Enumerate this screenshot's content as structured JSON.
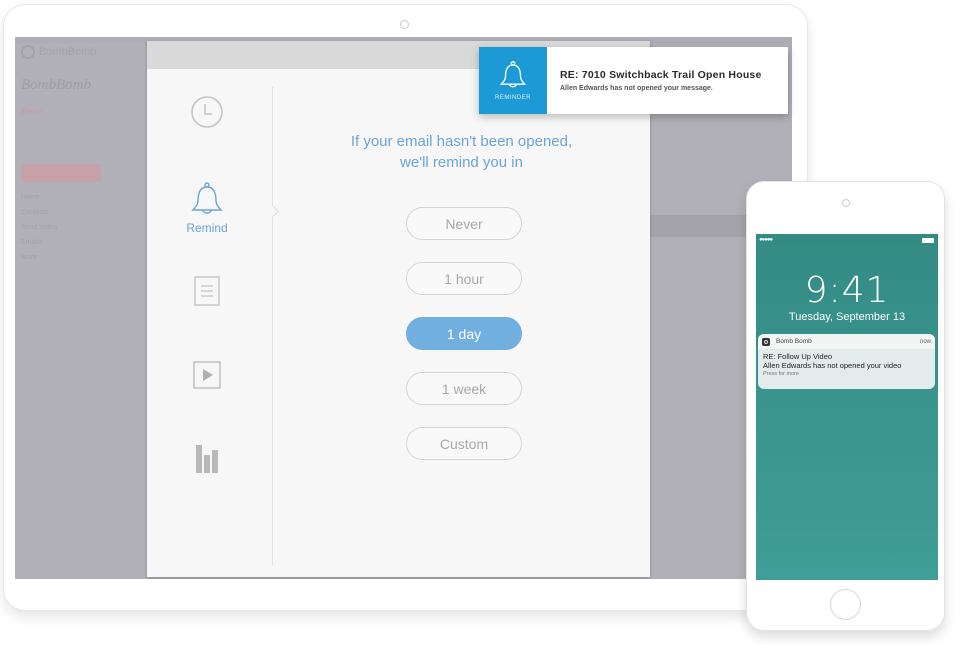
{
  "background_app": {
    "logo_text": "BombBomb",
    "brand_title": "BombBomb",
    "subtitle": "Menu",
    "nav_items": [
      "Home",
      "Contacts",
      "Send Video",
      "Emails",
      "More"
    ]
  },
  "modal": {
    "sidebar": [
      {
        "id": "schedule",
        "icon": "clock-icon",
        "label": "",
        "active": false
      },
      {
        "id": "remind",
        "icon": "bell-icon",
        "label": "Remind",
        "active": true
      },
      {
        "id": "notes",
        "icon": "document-icon",
        "label": "",
        "active": false
      },
      {
        "id": "video",
        "icon": "play-icon",
        "label": "",
        "active": false
      },
      {
        "id": "analytics",
        "icon": "bar-chart-icon",
        "label": "",
        "active": false
      }
    ],
    "prompt_line1": "If your email hasn't been opened,",
    "prompt_line2": "we'll remind you in",
    "options": [
      {
        "label": "Never",
        "selected": false
      },
      {
        "label": "1 hour",
        "selected": false
      },
      {
        "label": "1 day",
        "selected": true
      },
      {
        "label": "1 week",
        "selected": false
      },
      {
        "label": "Custom",
        "selected": false
      }
    ]
  },
  "toast": {
    "badge_label": "REMINDER",
    "title": "RE: 7010 Switchback Trail Open House",
    "message": "Allen Edwards has not opened your message."
  },
  "phone": {
    "signal": "●●●●●",
    "time": "9:41",
    "date": "Tuesday, September 13",
    "notification": {
      "app_name": "Bomb Bomb",
      "time": "now",
      "title": "RE: Follow Up Video",
      "message": "Allen Edwards has not opened your video",
      "hint": "Press for more"
    }
  },
  "colors": {
    "accent_blue": "#6aa5d5",
    "selected_option": "#71afe0",
    "reminder_badge": "#1b9ad6",
    "phone_screen": "#3a958e"
  }
}
